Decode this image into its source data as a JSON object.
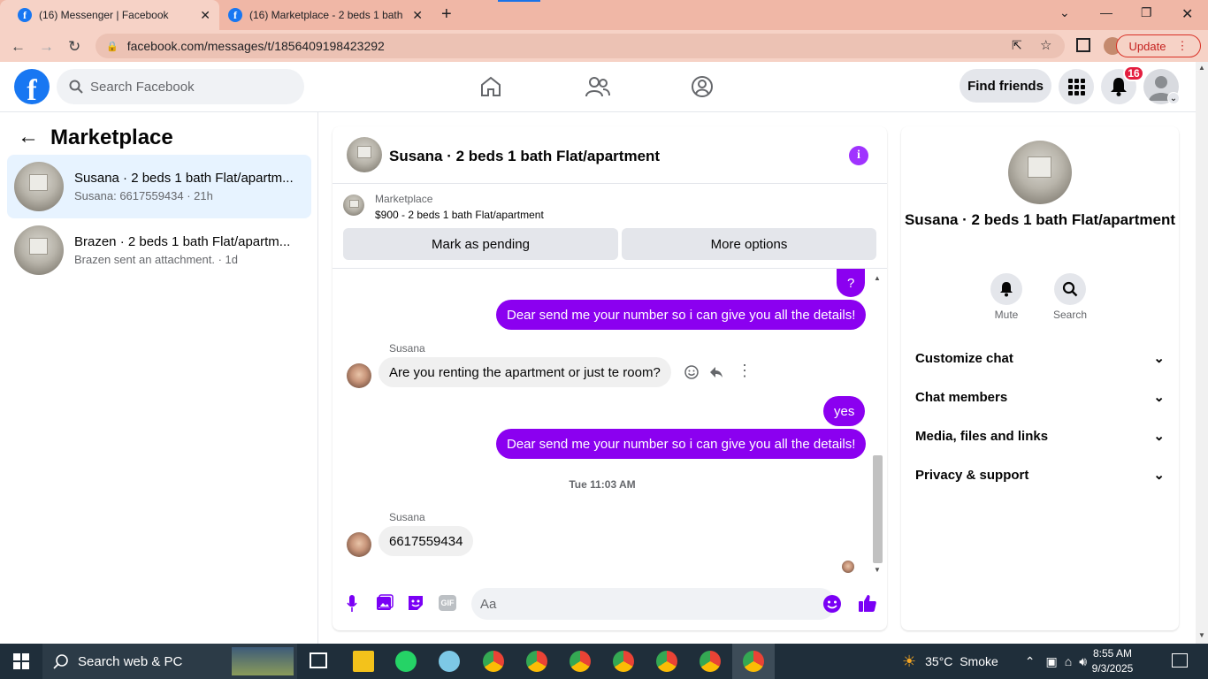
{
  "browser": {
    "tabs": [
      {
        "title": "(16) Messenger | Facebook",
        "active": true
      },
      {
        "title": "(16) Marketplace - 2 beds 1 bath",
        "active": false
      }
    ],
    "url": "facebook.com/messages/t/1856409198423292",
    "update_label": "Update"
  },
  "fb_header": {
    "search_placeholder": "Search Facebook",
    "find_friends": "Find friends",
    "notification_count": "16"
  },
  "sidebar": {
    "title": "Marketplace",
    "conversations": [
      {
        "name": "Susana · 2 beds 1 bath Flat/apartm...",
        "preview": "Susana: 6617559434 · 21h",
        "selected": true
      },
      {
        "name": "Brazen · 2 beds 1 bath Flat/apartm...",
        "preview": "Brazen sent an attachment. · 1d",
        "selected": false
      }
    ]
  },
  "chat": {
    "title": "Susana · 2 beds 1 bath Flat/apartment",
    "listing": {
      "source": "Marketplace",
      "summary": "$900 - 2 beds 1 bath Flat/apartment",
      "mark_pending": "Mark as pending",
      "more_options": "More options"
    },
    "messages": {
      "out_q": "?",
      "out_1": "Dear send me your number so i can give you all the details!",
      "sender_1": "Susana",
      "in_1": "Are you renting the apartment or just te room?",
      "out_2": "yes",
      "out_3": "Dear send me your number so i can give you all the details!",
      "timestamp": "Tue 11:03 AM",
      "sender_2": "Susana",
      "in_2": "6617559434"
    },
    "composer_placeholder": "Aa"
  },
  "right_panel": {
    "name": "Susana · 2 beds 1 bath Flat/apartment",
    "mute": "Mute",
    "search": "Search",
    "sections": [
      "Customize chat",
      "Chat members",
      "Media, files and links",
      "Privacy & support"
    ]
  },
  "taskbar": {
    "search": "Search web & PC",
    "weather": "35°C  Smoke",
    "time": "8:55 AM",
    "date": "9/3/2025"
  },
  "colors": {
    "fb_blue": "#1877f2",
    "bubble_purple": "#8b00f0",
    "selected_row": "#e7f3ff"
  }
}
